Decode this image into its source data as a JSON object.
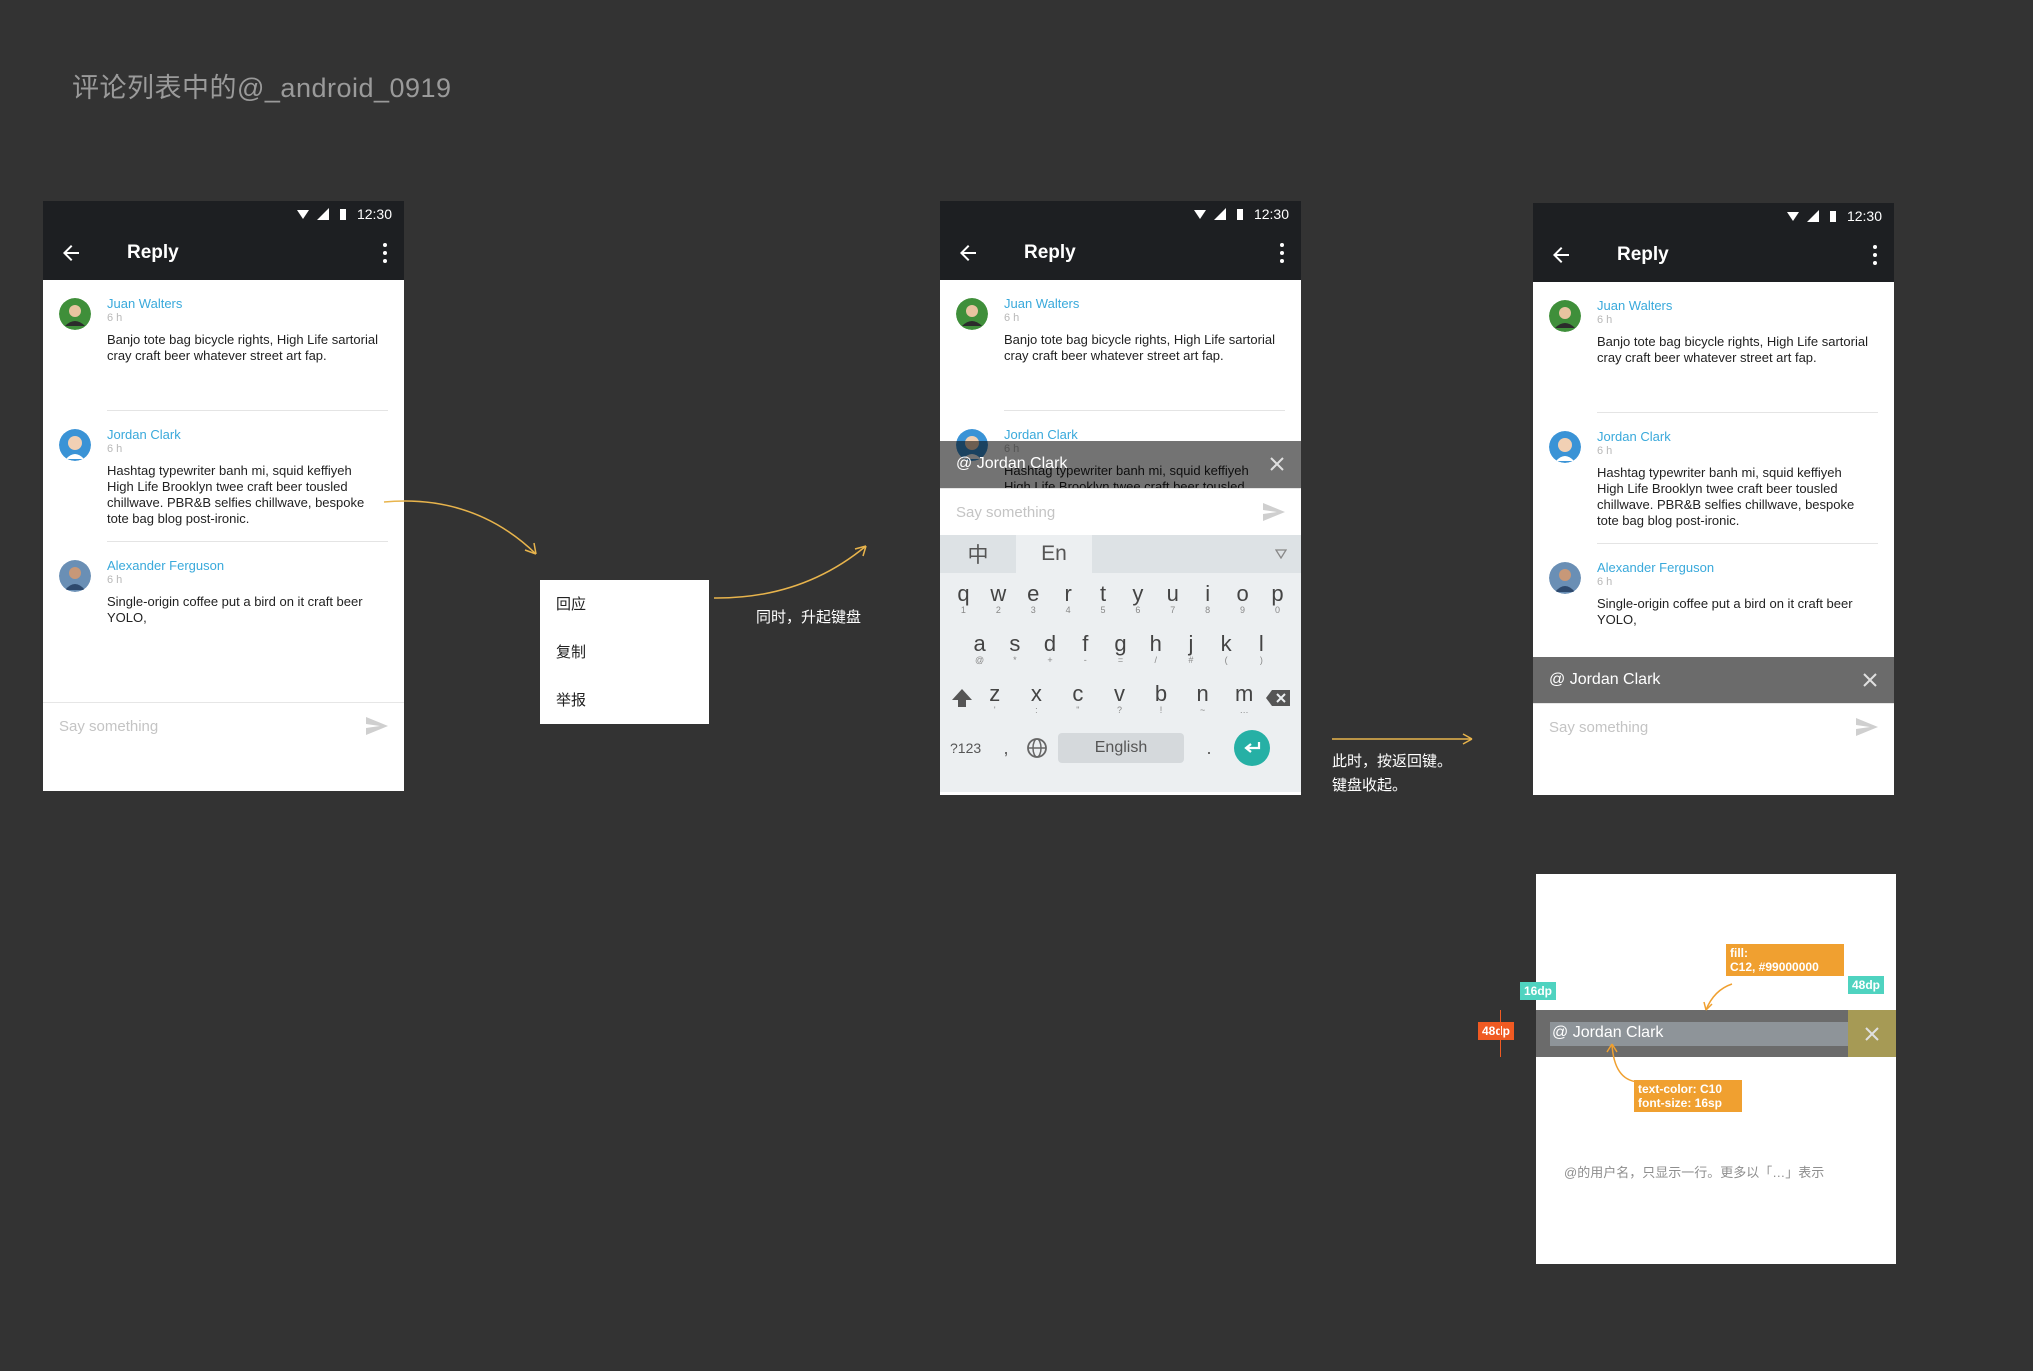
{
  "page_title": "评论列表中的@_android_0919",
  "status_time": "12:30",
  "appbar_title": "Reply",
  "comments": [
    {
      "name": "Juan Walters",
      "time": "6 h",
      "text": "Banjo tote bag bicycle rights, High Life sartorial cray craft beer whatever street art fap."
    },
    {
      "name": "Jordan Clark",
      "time": "6 h",
      "text": "Hashtag typewriter banh mi, squid keffiyeh High Life Brooklyn twee craft beer tousled chillwave. PBR&B selfies chillwave, bespoke tote bag blog post-ironic."
    },
    {
      "name": "Alexander Ferguson",
      "time": "6 h",
      "text": "Single-origin coffee put a bird on it craft beer YOLO,"
    }
  ],
  "input_placeholder": "Say something",
  "context_menu": [
    "回应",
    "复制",
    "举报"
  ],
  "annotation_1": "同时，升起键盘",
  "annotation_2_line1": "此时，按返回键。",
  "annotation_2_line2": "键盘收起。",
  "mention_text": "@ Jordan Clark",
  "keyboard": {
    "lang_zh": "中",
    "lang_en": "En",
    "row1": [
      [
        "q",
        "1"
      ],
      [
        "w",
        "2"
      ],
      [
        "e",
        "3"
      ],
      [
        "r",
        "4"
      ],
      [
        "t",
        "5"
      ],
      [
        "y",
        "6"
      ],
      [
        "u",
        "7"
      ],
      [
        "i",
        "8"
      ],
      [
        "o",
        "9"
      ],
      [
        "p",
        "0"
      ]
    ],
    "row2": [
      [
        "a",
        "@"
      ],
      [
        "s",
        "*"
      ],
      [
        "d",
        "+"
      ],
      [
        "f",
        "-"
      ],
      [
        "g",
        "="
      ],
      [
        "h",
        "/"
      ],
      [
        "j",
        "#"
      ],
      [
        "k",
        "("
      ],
      [
        "l",
        ")"
      ]
    ],
    "row3": [
      [
        "z",
        "'"
      ],
      [
        "x",
        ":"
      ],
      [
        "c",
        "\""
      ],
      [
        "v",
        "?"
      ],
      [
        "b",
        "!"
      ],
      [
        "n",
        "~"
      ],
      [
        "m",
        "…"
      ]
    ],
    "sym_key": "?123",
    "comma_key": ",",
    "space_label": "English",
    "period_key": "."
  },
  "spec": {
    "fill_tag_line1": "fill:",
    "fill_tag_line2": "C12, #99000000",
    "padding_tag": "16dp",
    "width_tag": "48dp",
    "height_tag": "48dp",
    "text_tag_line1": "text-color: C10",
    "text_tag_line2": "font-size: 16sp",
    "note": "@的用户名，只显示一行。更多以「…」表示"
  },
  "colors": {
    "accent": "#39a9db",
    "appbar": "#1d1f22",
    "mention_bar": "#6b6b6b",
    "tag_orange": "#f0a030",
    "tag_green": "#4fd3c0",
    "tag_red": "#f05a22",
    "enter_key": "#26b0a5"
  }
}
